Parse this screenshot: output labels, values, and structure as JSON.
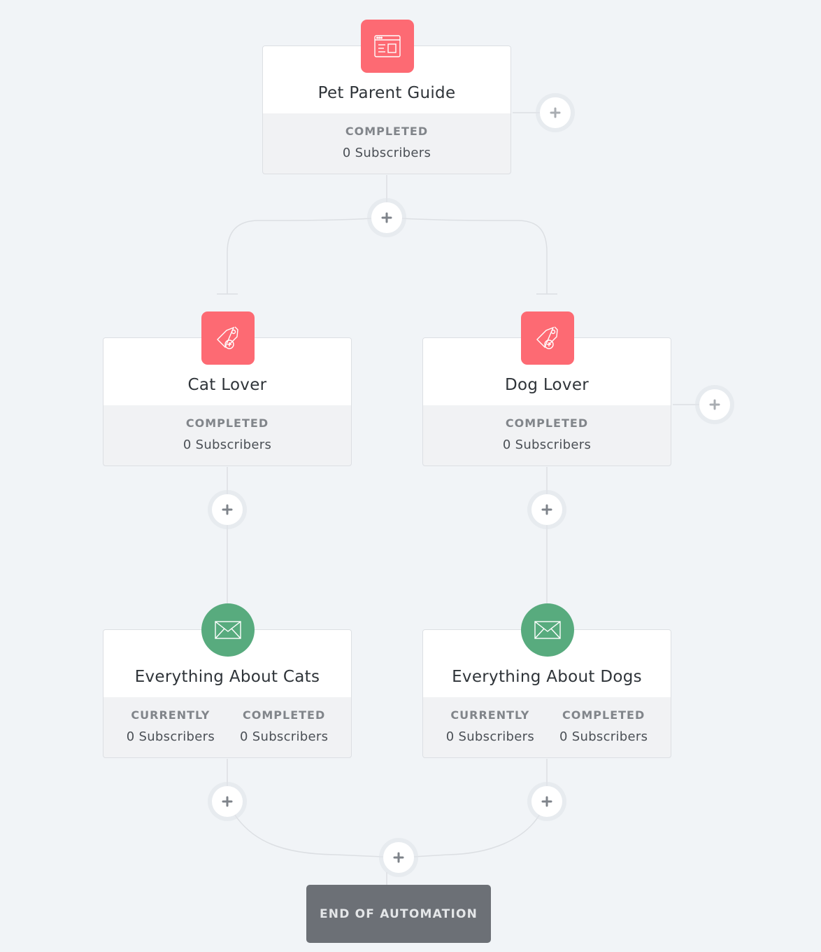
{
  "colors": {
    "background": "#f1f4f7",
    "action_badge": "#fd6a73",
    "email_badge": "#58ab7e",
    "end_block": "#6c7076"
  },
  "nodes": {
    "pet_parent_guide": {
      "title": "Pet Parent Guide",
      "icon": "form-window-icon",
      "stats": [
        {
          "label": "COMPLETED",
          "value": "0 Subscribers"
        }
      ]
    },
    "cat_lover": {
      "title": "Cat Lover",
      "icon": "add-tag-icon",
      "stats": [
        {
          "label": "COMPLETED",
          "value": "0 Subscribers"
        }
      ]
    },
    "dog_lover": {
      "title": "Dog Lover",
      "icon": "add-tag-icon",
      "stats": [
        {
          "label": "COMPLETED",
          "value": "0 Subscribers"
        }
      ]
    },
    "everything_cats": {
      "title": "Everything About Cats",
      "icon": "envelope-icon",
      "stats": [
        {
          "label": "CURRENTLY",
          "value": "0 Subscribers"
        },
        {
          "label": "COMPLETED",
          "value": "0 Subscribers"
        }
      ]
    },
    "everything_dogs": {
      "title": "Everything About Dogs",
      "icon": "envelope-icon",
      "stats": [
        {
          "label": "CURRENTLY",
          "value": "0 Subscribers"
        },
        {
          "label": "COMPLETED",
          "value": "0 Subscribers"
        }
      ]
    }
  },
  "end": {
    "label": "END OF AUTOMATION"
  },
  "add_step_icon": "plus-icon"
}
